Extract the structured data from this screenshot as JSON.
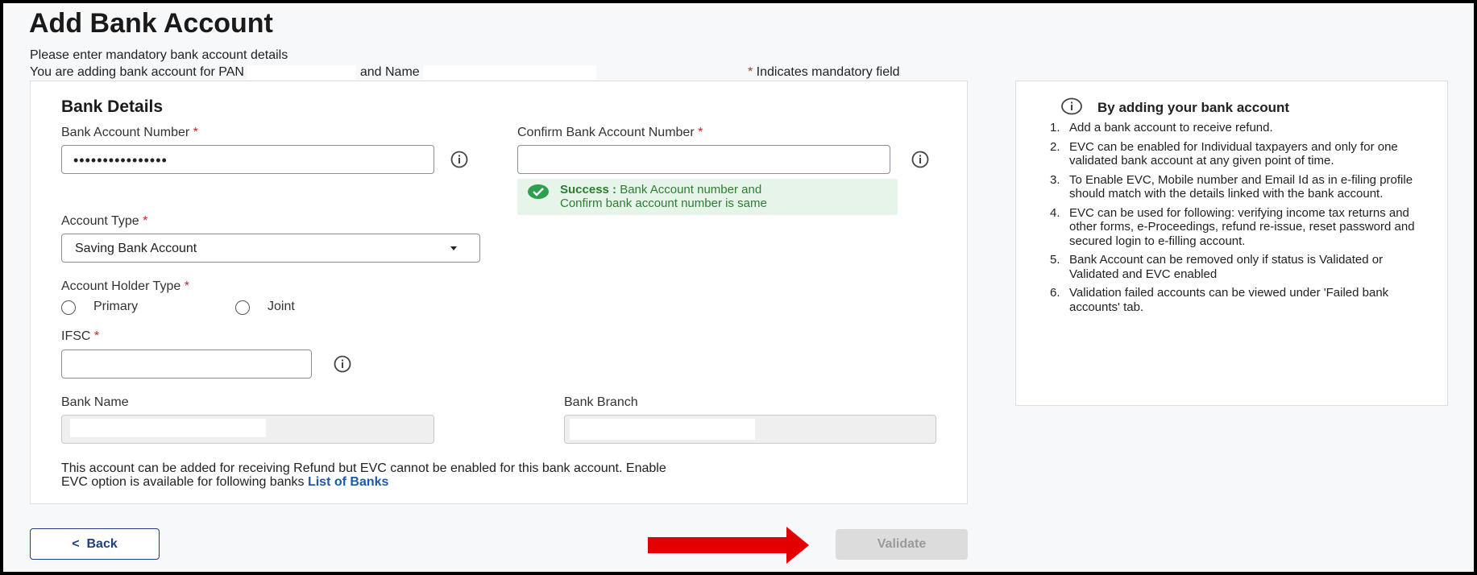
{
  "page": {
    "title": "Add Bank Account",
    "instruction": "Please enter mandatory bank account details",
    "pan_prefix": "You are adding bank account for PAN ",
    "name_label": " and Name",
    "mandatory_star": "*",
    "mandatory_text": " Indicates mandatory field"
  },
  "bank_details": {
    "heading": "Bank Details",
    "account_number_label": "Bank Account Number ",
    "account_number_value": "••••••••••••••••",
    "confirm_label": "Confirm Bank Account Number ",
    "confirm_value": "",
    "required_star": "*",
    "success_title": "Success :",
    "success_line1": " Bank Account number and",
    "success_line2": "Confirm bank account number is same",
    "account_type_label": "Account Type ",
    "account_type_value": "Saving Bank Account",
    "holder_type_label": "Account Holder Type ",
    "holder_options": [
      "Primary",
      "Joint"
    ],
    "ifsc_label": "IFSC ",
    "ifsc_value": "",
    "bank_name_label": "Bank Name",
    "bank_branch_label": "Bank Branch",
    "note_line1": "This account can be added for receiving Refund but EVC cannot be enabled for this bank account. Enable",
    "note_line2": "EVC option is available for following banks ",
    "list_of_banks_link": "List of Banks"
  },
  "info_panel": {
    "title": "By adding your bank account",
    "items": [
      {
        "num": "1.",
        "text": "Add a bank account to receive refund."
      },
      {
        "num": "2.",
        "text": "EVC can be enabled for Individual taxpayers and only for one validated bank account at any given point of time."
      },
      {
        "num": "3.",
        "text": "To Enable EVC, Mobile number and Email Id as in e-filing profile should match with the details linked with the bank account."
      },
      {
        "num": "4.",
        "text": "EVC can be used for following: verifying income tax returns and other forms, e-Proceedings, refund re-issue, reset password and secured login to e-filling account."
      },
      {
        "num": "5.",
        "text": "Bank Account can be removed only if status is Validated or Validated and EVC enabled"
      },
      {
        "num": "6.",
        "text": "Validation failed accounts can be viewed under 'Failed bank accounts' tab."
      }
    ]
  },
  "footer": {
    "back_label": "Back",
    "back_chevron": "<",
    "validate_label": "Validate"
  },
  "colors": {
    "primary": "#1e3f7a",
    "required": "#c62828",
    "success_bg": "#e6f4ea",
    "success_text": "#2e7d32",
    "arrow": "#e30000",
    "disabled_btn": "#dcdcdc"
  }
}
